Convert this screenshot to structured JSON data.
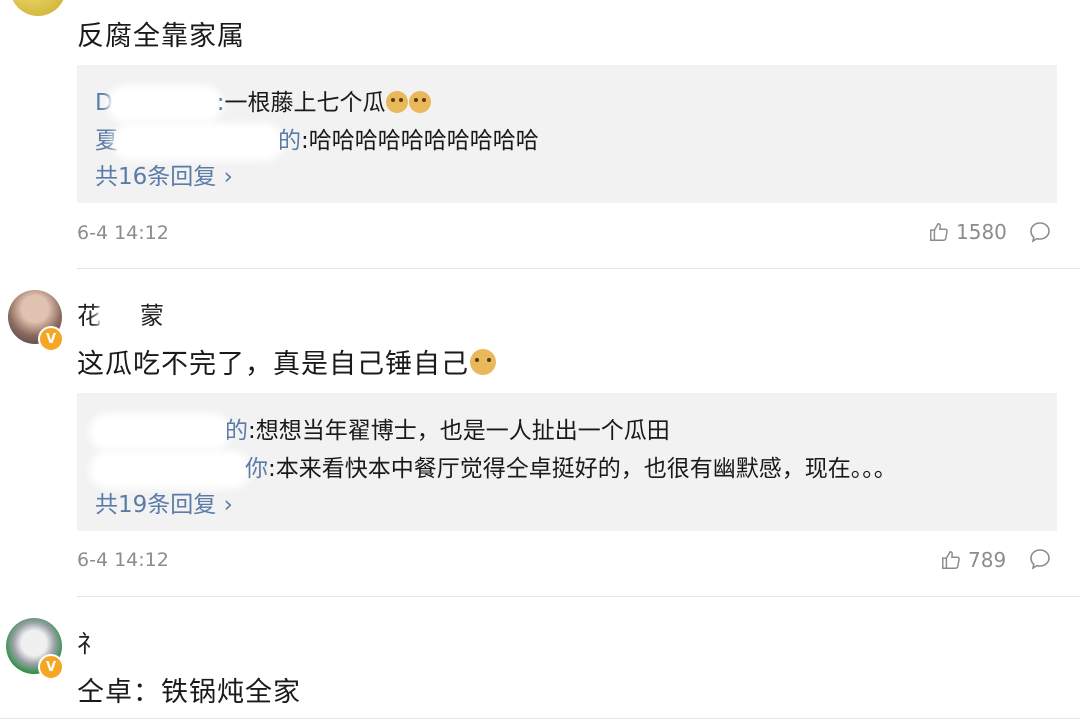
{
  "comments": [
    {
      "content": "反腐全靠家属",
      "replies": [
        {
          "name_tail": ":",
          "name_visible": "D",
          "text": "一根藤上七个瓜"
        },
        {
          "name_visible": "夏",
          "name_tail": "的",
          "text": "哈哈哈哈哈哈哈哈哈哈"
        }
      ],
      "more": "共16条回复",
      "time": "6-4 14:12",
      "likes": "1580"
    },
    {
      "author": "花",
      "author_tail": "蒙",
      "content": "这瓜吃不完了，真是自己锤自己",
      "replies": [
        {
          "name_visible": "",
          "name_tail": "的",
          "text": "想想当年翟博士，也是一人扯出一个瓜田"
        },
        {
          "name_visible": "",
          "name_tail": "你",
          "text": "本来看快本中餐厅觉得仝卓挺好的，也很有幽默感，现在。。。"
        }
      ],
      "more": "共19条回复",
      "time": "6-4 14:12",
      "likes": "789"
    },
    {
      "author": "礻",
      "content": "仝卓：铁锅炖全家"
    }
  ],
  "badge": "V",
  "colors": {
    "link": "#5b7ba8",
    "reply_bg": "#f2f2f2",
    "meta": "#8c8c8c",
    "badge": "#f5a623"
  }
}
